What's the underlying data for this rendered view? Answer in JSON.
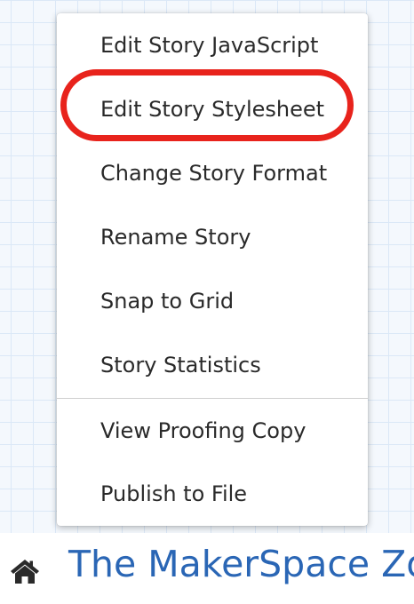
{
  "menu": {
    "items": [
      {
        "label": "Edit Story JavaScript"
      },
      {
        "label": "Edit Story Stylesheet"
      },
      {
        "label": "Change Story Format"
      },
      {
        "label": "Rename Story"
      },
      {
        "label": "Snap to Grid"
      },
      {
        "label": "Story Statistics"
      },
      {
        "label": "View Proofing Copy"
      },
      {
        "label": "Publish to File"
      }
    ],
    "highlighted_item": "Edit Story Stylesheet"
  },
  "footer": {
    "icon": "home-icon",
    "story_title": "The MakerSpace Zo"
  },
  "colors": {
    "highlight": "#e8231c",
    "title": "#2a66b5",
    "grid_line": "#dbe8f7",
    "background": "#f4f8fd"
  }
}
